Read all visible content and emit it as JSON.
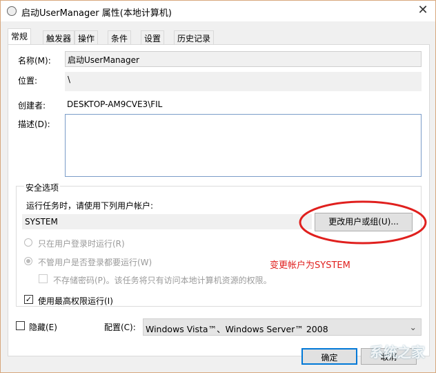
{
  "window": {
    "title": "启动UserManager 属性(本地计算机)",
    "close": "✕"
  },
  "tabs": [
    "常规",
    "触发器",
    "操作",
    "条件",
    "设置",
    "历史记录"
  ],
  "general": {
    "name_label": "名称(M):",
    "name_value": "启动UserManager",
    "location_label": "位置:",
    "location_value": "\\",
    "author_label": "创建者:",
    "author_value": "DESKTOP-AM9CVE3\\FIL",
    "description_label": "描述(D):",
    "description_value": ""
  },
  "security": {
    "group_label": "安全选项",
    "run_as_label": "运行任务时，请使用下列用户帐户:",
    "account": "SYSTEM",
    "change_button": "更改用户或组(U)...",
    "radio_logged_on": "只在用户登录时运行(R)",
    "radio_whether": "不管用户是否登录都要运行(W)",
    "no_store_password": "不存储密码(P)。该任务将只有访问本地计算机资源的权限。",
    "highest_privileges": "使用最高权限运行(I)",
    "highest_checked": true,
    "annotation": "变更帐户为SYSTEM",
    "annotation_color": "#e0201e"
  },
  "bottom": {
    "hidden_label": "隐藏(E)",
    "configure_label": "配置(C):",
    "configure_value": "Windows Vista™、Windows Server™ 2008",
    "ok": "确定",
    "cancel": "取消"
  },
  "watermark": "系统之家"
}
